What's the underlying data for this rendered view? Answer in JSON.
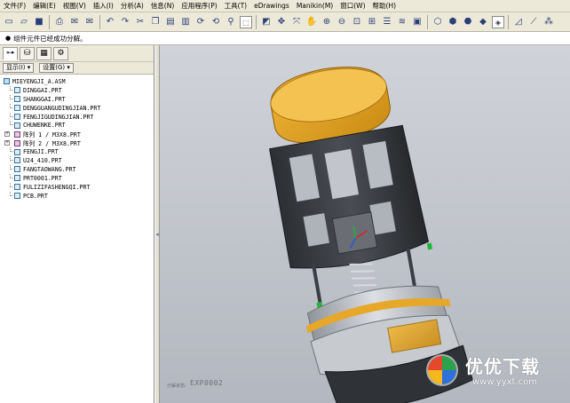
{
  "menu": [
    "文件(F)",
    "编辑(E)",
    "视图(V)",
    "插入(I)",
    "分析(A)",
    "信息(N)",
    "应用程序(P)",
    "工具(T)",
    "eDrawings",
    "Manikin(M)",
    "窗口(W)",
    "帮助(H)"
  ],
  "message": "组件元件已经成功分解。",
  "panel_buttons": {
    "show": "显示(I) ▾",
    "settings": "设置(G) ▾"
  },
  "tree": {
    "root": "MIEYENGJI_A.ASM",
    "items": [
      {
        "label": "DINGGAI.PRT",
        "type": "prt"
      },
      {
        "label": "SHANGGAI.PRT",
        "type": "prt"
      },
      {
        "label": "DENGGUANGUDINGJIAN.PRT",
        "type": "prt"
      },
      {
        "label": "FENGJIGUDINGJIAN.PRT",
        "type": "prt"
      },
      {
        "label": "CHUWENKE.PRT",
        "type": "prt"
      },
      {
        "label": "阵列 1 / M3X8.PRT",
        "type": "pattern"
      },
      {
        "label": "阵列 2 / M3X8.PRT",
        "type": "pattern"
      },
      {
        "label": "FENGJI.PRT",
        "type": "prt"
      },
      {
        "label": "U24_410.PRT",
        "type": "prt"
      },
      {
        "label": "FANGTAOWANG.PRT",
        "type": "prt"
      },
      {
        "label": "PRT0001.PRT",
        "type": "prt"
      },
      {
        "label": "FULIZIFASHENGQI.PRT",
        "type": "prt"
      },
      {
        "label": "PCB.PRT",
        "type": "prt"
      }
    ]
  },
  "viewport": {
    "explode_label": "分解状态:",
    "explode_state": "EXP0002"
  },
  "watermark": {
    "name": "优优下载",
    "url": "www.yyxt.com"
  },
  "colors": {
    "accent_orange": "#e0a020",
    "dark_shell": "#3a3d42",
    "viewport_bg": "#c5c8ce"
  }
}
